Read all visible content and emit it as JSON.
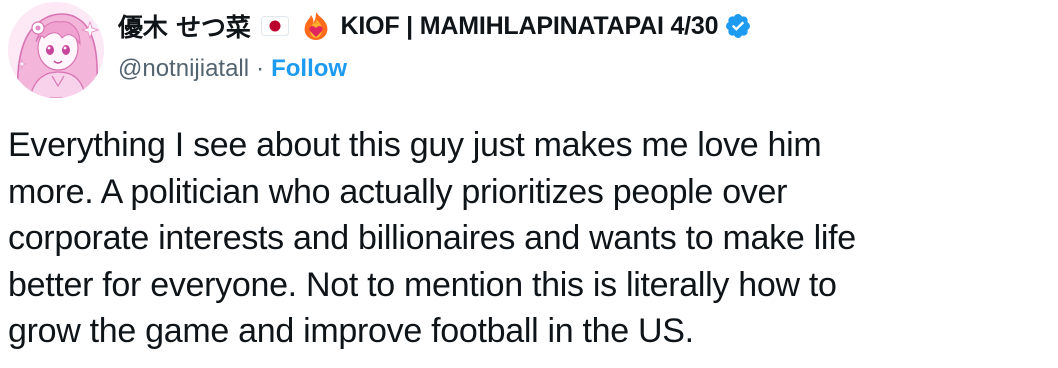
{
  "tweet": {
    "display_name_jp": "優木 せつ菜",
    "display_name_rest": "KIOF | MAMIHLAPINATAPAI 4/30",
    "handle": "@notnijiatall",
    "separator": "·",
    "follow_label": "Follow",
    "text_lines": [
      "Everything I see about this guy just makes me love him",
      "more. A politician who actually prioritizes people over",
      "corporate interests and billionaires and wants to make life",
      "better for everyone. Not to mention this is literally how to",
      "grow the game and improve football in the US."
    ]
  },
  "icons": {
    "avatar": "anime-character-avatar",
    "flag": "japan-flag-icon",
    "emoji": "fire-heart-icon",
    "badge": "verified-badge-icon"
  },
  "colors": {
    "text": "#0f1419",
    "secondary": "#536471",
    "accent": "#1d9bf0",
    "flag_red": "#bc002d",
    "fire": "#ff6b1a",
    "heart": "#e0245e"
  }
}
